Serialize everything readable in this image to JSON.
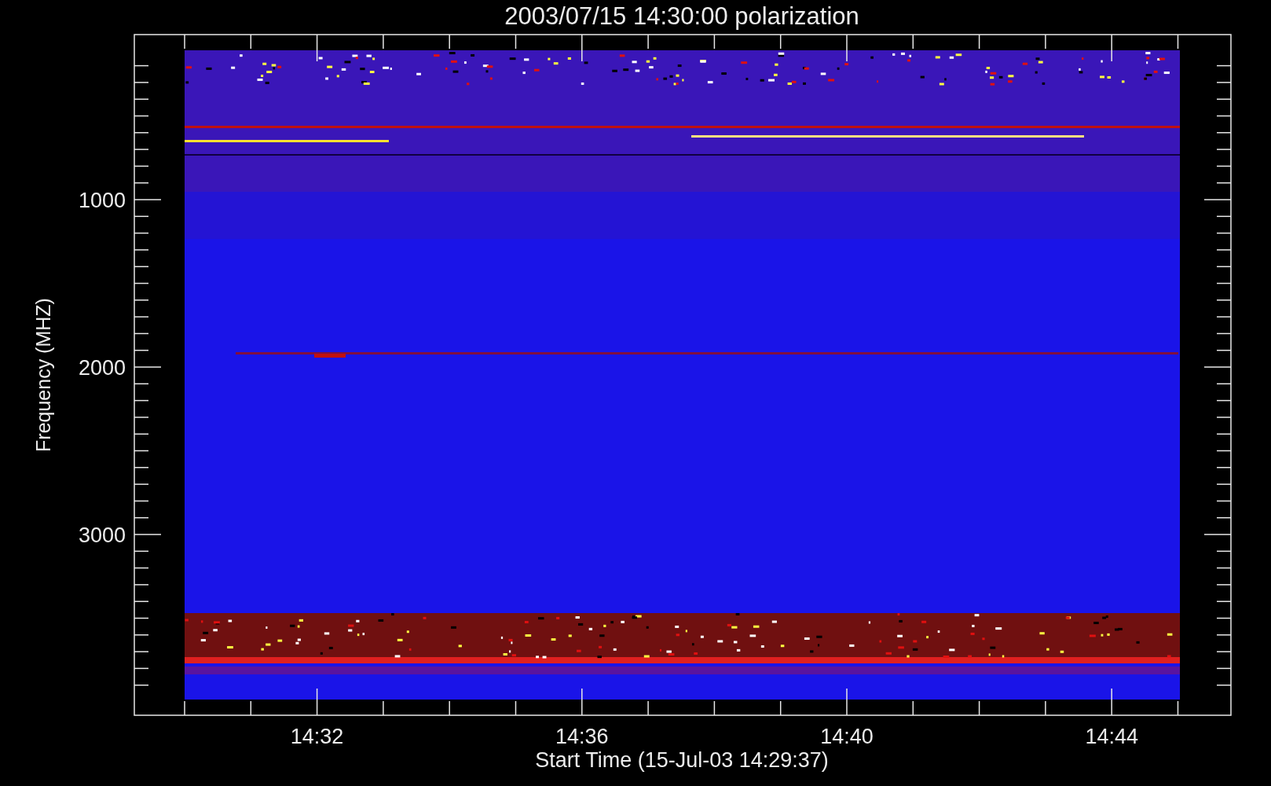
{
  "title": "2003/07/15 14:30:00 polarization",
  "y_axis": {
    "label": "Frequency (MHZ)",
    "tick_labels": [
      "1000",
      "2000",
      "3000"
    ]
  },
  "x_axis": {
    "label": "Start Time (15-Jul-03 14:29:37)",
    "tick_labels": [
      "14:32",
      "14:36",
      "14:40",
      "14:44"
    ]
  }
}
